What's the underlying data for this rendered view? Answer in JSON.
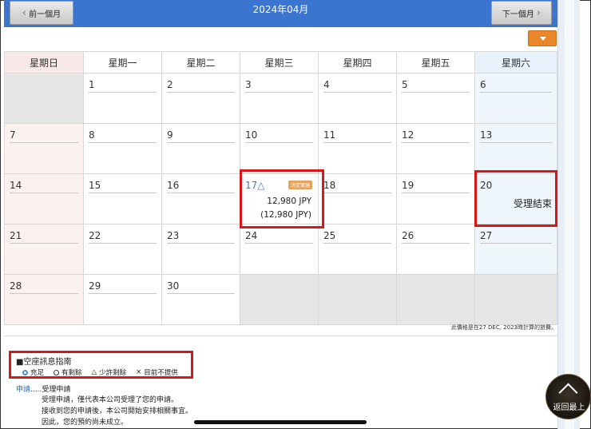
{
  "header": {
    "month": "2024年04月",
    "prev_label": "前一個月",
    "next_label": "下一個月"
  },
  "weekdays": [
    "星期日",
    "星期一",
    "星期二",
    "星期三",
    "星期四",
    "星期五",
    "星期六"
  ],
  "weeks": [
    [
      "",
      "1",
      "2",
      "3",
      "4",
      "5",
      "6"
    ],
    [
      "7",
      "8",
      "9",
      "10",
      "11",
      "12",
      "13"
    ],
    [
      "14",
      "15",
      "16",
      "17△",
      "18",
      "19",
      "20"
    ],
    [
      "21",
      "22",
      "23",
      "24",
      "25",
      "26",
      "27"
    ],
    [
      "28",
      "29",
      "30",
      "",
      "",
      "",
      ""
    ]
  ],
  "availability": {
    "day17": {
      "badge": "決定實施",
      "price": "12,980 JPY",
      "price_sub": "(12,980 JPY)"
    },
    "day20": {
      "status": "受理結束"
    }
  },
  "price_note": "此價格是在27 DEC, 2023時計算的旅費。",
  "legend": {
    "title": "■空座訊息指南",
    "items": [
      "充足",
      "有剩餘",
      "少許剩餘",
      "目前不提供"
    ],
    "symbols": [
      "",
      "",
      "△",
      "×"
    ]
  },
  "request_info": {
    "key": "申請",
    "dots": ".....",
    "name": "受理申請",
    "lines": [
      "受理申請，僅代表本公司受理了您的申請。",
      "接收到您的申請後，本公司開始安排相關事宜。",
      "因此，您的預約尚未成立。"
    ]
  },
  "back_to_top": "返回最上",
  "colors": {
    "header_blue": "#3b75cf",
    "sunday_bg": "#fbf1ef",
    "saturday_bg": "#eef6fc",
    "highlight_red": "#d81818",
    "dropdown_orange": "#e8882a"
  }
}
